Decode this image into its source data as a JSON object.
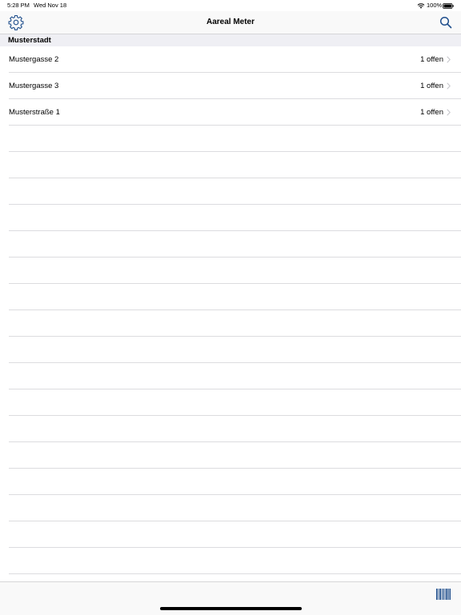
{
  "status_bar": {
    "time": "5:28 PM",
    "date": "Wed Nov 18",
    "battery_percent": "100%"
  },
  "nav": {
    "title": "Aareal Meter",
    "left_icon": "gear-icon",
    "right_icon": "search-icon"
  },
  "section": {
    "title": "Musterstadt"
  },
  "rows": [
    {
      "label": "Mustergasse 2",
      "detail": "1 offen"
    },
    {
      "label": "Mustergasse 3",
      "detail": "1 offen"
    },
    {
      "label": "Musterstraße 1",
      "detail": "1 offen"
    }
  ],
  "toolbar": {
    "right_icon": "barcode-icon"
  },
  "colors": {
    "accent": "#1f4e8c",
    "chevron": "#c7c7cc",
    "separator": "#dcdcdf"
  }
}
